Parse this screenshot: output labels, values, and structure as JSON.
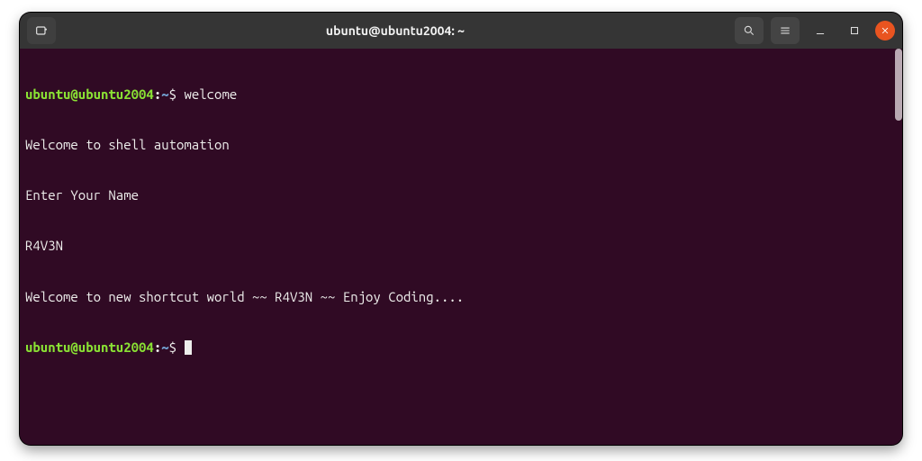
{
  "titlebar": {
    "title": "ubuntu@ubuntu2004: ~"
  },
  "prompt": {
    "user_host": "ubuntu@ubuntu2004",
    "sep": ":",
    "path": "~",
    "symbol": "$"
  },
  "session": {
    "cmd1": "welcome",
    "out1": "Welcome to shell automation",
    "out2": "Enter Your Name",
    "out3": "R4V3N",
    "out4": "Welcome to new shortcut world ~~ R4V3N ~~ Enjoy Coding...."
  }
}
